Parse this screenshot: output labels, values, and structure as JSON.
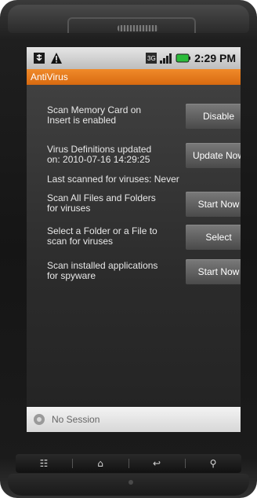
{
  "status": {
    "time": "2:29 PM",
    "icons": [
      "usb-icon",
      "warning-icon",
      "3g-icon",
      "signal-icon",
      "battery-icon"
    ]
  },
  "app": {
    "title": "AntiVirus"
  },
  "items": [
    {
      "text": "Scan Memory Card on\nInsert is enabled",
      "button": "Disable"
    },
    {
      "text": "Virus Definitions updated\non: 2010-07-16  14:29:25",
      "button": "Update Now"
    },
    {
      "text": "Last scanned for viruses: Never"
    },
    {
      "text": "Scan All Files and Folders\nfor viruses",
      "button": "Start Now"
    },
    {
      "text": "Select a Folder or a File to\nscan for viruses",
      "button": "Select"
    },
    {
      "text": "Scan installed applications\nfor spyware",
      "button": "Start Now"
    }
  ],
  "session": {
    "label": "No Session"
  },
  "nav": {
    "menu": "☷",
    "home": "⌂",
    "back": "↩",
    "search": "⚲"
  },
  "colors": {
    "accent": "#f08a2a",
    "panel": "#333333"
  }
}
